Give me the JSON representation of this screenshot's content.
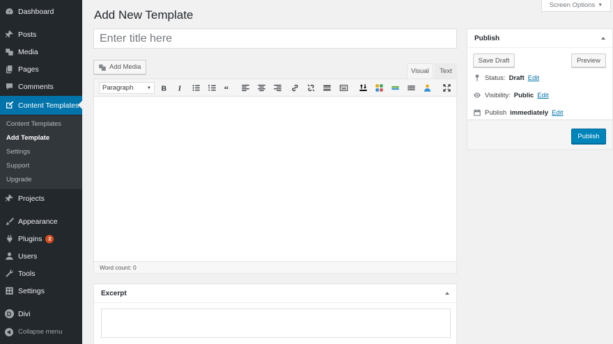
{
  "screen_options": {
    "label": "Screen Options"
  },
  "page": {
    "title": "Add New Template"
  },
  "title_field": {
    "placeholder": "Enter title here",
    "value": ""
  },
  "sidebar": {
    "items": [
      {
        "label": "Dashboard",
        "icon": "dashboard-icon"
      },
      {
        "label": "Posts",
        "icon": "pin-icon"
      },
      {
        "label": "Media",
        "icon": "media-icon"
      },
      {
        "label": "Pages",
        "icon": "pages-icon"
      },
      {
        "label": "Comments",
        "icon": "comments-icon"
      },
      {
        "label": "Content Templates",
        "icon": "edit-icon",
        "active": true
      },
      {
        "label": "Projects",
        "icon": "pin-icon"
      },
      {
        "label": "Appearance",
        "icon": "brush-icon"
      },
      {
        "label": "Plugins",
        "icon": "plugin-icon",
        "badge": "2"
      },
      {
        "label": "Users",
        "icon": "users-icon"
      },
      {
        "label": "Tools",
        "icon": "wrench-icon"
      },
      {
        "label": "Settings",
        "icon": "settings-icon"
      },
      {
        "label": "Divi",
        "icon": "divi-logo-icon"
      },
      {
        "label": "Collapse menu",
        "icon": "collapse-icon"
      }
    ],
    "submenu": [
      {
        "label": "Content Templates"
      },
      {
        "label": "Add Template",
        "current": true
      },
      {
        "label": "Settings"
      },
      {
        "label": "Support"
      },
      {
        "label": "Upgrade"
      }
    ]
  },
  "editor": {
    "add_media_label": "Add Media",
    "tab_visual": "Visual",
    "tab_text": "Text",
    "format_select": "Paragraph",
    "word_count": "Word count: 0",
    "toolbar_icons": [
      "bold-icon",
      "italic-icon",
      "bullet-list-icon",
      "numbered-list-icon",
      "blockquote-icon",
      "align-left-icon",
      "align-center-icon",
      "align-right-icon",
      "link-icon",
      "unlink-icon",
      "more-tag-icon",
      "toolbar-toggle-icon",
      "insert-shortcode-icon",
      "layout-grid-icon",
      "divider-icon",
      "text-lines-icon",
      "person-icon",
      "fullscreen-icon"
    ]
  },
  "excerpt": {
    "title": "Excerpt",
    "value": ""
  },
  "publish": {
    "title": "Publish",
    "save_draft": "Save Draft",
    "preview": "Preview",
    "status_label": "Status:",
    "status_value": "Draft",
    "visibility_label": "Visibility:",
    "visibility_value": "Public",
    "publish_label": "Publish",
    "publish_value": "immediately",
    "edit_link": "Edit",
    "publish_button": "Publish"
  },
  "colors": {
    "sidebar_bg": "#23282d",
    "accent": "#0073aa",
    "primary_button": "#0085ba",
    "badge": "#d54e21"
  }
}
